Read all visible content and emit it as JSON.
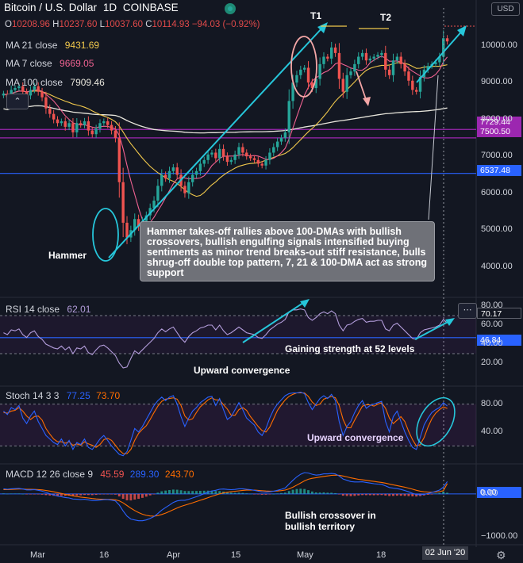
{
  "symbol": {
    "title": "Bitcoin / U.S. Dollar",
    "interval": "1D",
    "exchange": "COINBASE",
    "currency": "USD",
    "ohlc": {
      "o_label": "O",
      "o": "10208.96",
      "h_label": "H",
      "h": "10237.60",
      "l_label": "L",
      "l": "10037.60",
      "c_label": "C",
      "c": "10114.93",
      "change": "−94.03 (−0.92%)"
    }
  },
  "indicators": {
    "ma21": {
      "label": "MA 21 close",
      "value": "9431.69",
      "color": "#f2c94c"
    },
    "ma7": {
      "label": "MA 7 close",
      "value": "9669.05",
      "color": "#f06292"
    },
    "ma100": {
      "label": "MA 100 close",
      "value": "7909.46",
      "color": "#e8e6dc"
    },
    "rsi": {
      "label": "RSI 14 close",
      "value": "62.01",
      "color": "#b39ddb"
    },
    "stoch": {
      "label": "Stoch 14 3 3",
      "k": "77.25",
      "d": "73.70",
      "k_color": "#2962ff",
      "d_color": "#ff6d00"
    },
    "macd": {
      "label": "MACD 12 26 close 9",
      "hist": "45.59",
      "macd": "289.30",
      "signal": "243.70",
      "hist_color": "#ef5350",
      "macd_color": "#2962ff",
      "signal_color": "#ff6d00"
    }
  },
  "annotations": {
    "t1": "T1",
    "t2": "T2",
    "hammer": "Hammer",
    "note": "Hammer takes-off rallies above 100-DMAs with bullish crossovers, bullish engulfing signals intensified buying sentiments as minor trend breaks-out stiff resistance, bulls shrug-off double top pattern, 7, 21 & 100-DMA act as strong support",
    "rsi_text1": "Gaining strength at 52 levels",
    "rsi_text2": "Upward convergence",
    "stoch_text": "Upward convergence",
    "macd_text": "Bullish crossover in bullish territory"
  },
  "price_badges": [
    {
      "value": "7729.44",
      "color": "#9c27b0"
    },
    {
      "value": "7500.50",
      "color": "#9c27b0"
    },
    {
      "value": "6537.48",
      "color": "#2962ff"
    }
  ],
  "side_badges": {
    "rsi_a": "70.17",
    "rsi_b": "46.84",
    "macd_zero": "0.00"
  },
  "x_axis": {
    "ticks": [
      "Mar",
      "16",
      "Apr",
      "15",
      "May",
      "18"
    ],
    "cursor_date": "02 Jun '20"
  },
  "chart_data": [
    {
      "type": "candlestick",
      "pane": "price",
      "ylim": [
        3500,
        10700
      ],
      "y_ticks": [
        10000,
        9000,
        8000,
        7000,
        6000,
        5000,
        4000
      ],
      "y_tick_labels": [
        "10000.00",
        "9000.00",
        "8000.00",
        "7000.00",
        "6000.00",
        "5000.00",
        "4000.00"
      ],
      "candles_close": [
        8700,
        8600,
        8800,
        8850,
        8900,
        8750,
        8650,
        8800,
        8900,
        8750,
        8600,
        8300,
        8150,
        8000,
        7900,
        7950,
        7800,
        7900,
        7650,
        7900,
        7850,
        7950,
        7700,
        7600,
        7750,
        7900,
        7950,
        7850,
        7700,
        7500,
        6300,
        5200,
        4800,
        5000,
        5300,
        5100,
        5250,
        5400,
        5600,
        5800,
        6200,
        6500,
        6400,
        6600,
        6700,
        6500,
        6200,
        6000,
        6300,
        6500,
        6600,
        6800,
        6900,
        7050,
        7100,
        6950,
        7200,
        7000,
        6850,
        6900,
        7050,
        7250,
        7100,
        7000,
        6950,
        6900,
        6800,
        6750,
        6900,
        7100,
        7250,
        7400,
        7500,
        7650,
        8500,
        9000,
        9200,
        9350,
        9400,
        9000,
        8850,
        9100,
        9500,
        9700,
        9650,
        9950,
        9800,
        9100,
        8750,
        9200,
        9300,
        9500,
        9700,
        9800,
        9600,
        9650,
        9700,
        9750,
        9800,
        9350,
        9200,
        9600,
        9700,
        9500,
        9300,
        9050,
        8800,
        8750,
        9150,
        9350,
        9450,
        9500,
        9550,
        9700,
        10200,
        10114.93
      ],
      "hline_levels": [
        7729.44,
        7500.5,
        6537.48
      ]
    },
    {
      "type": "line",
      "pane": "rsi",
      "ylim": [
        10,
        85
      ],
      "y_ticks": [
        80,
        60,
        40,
        20
      ],
      "y_tick_labels": [
        "80.00",
        "60.00",
        "40.00",
        "20.00"
      ],
      "series": [
        {
          "name": "RSI 14 close",
          "values": [
            52,
            50,
            55,
            54,
            56,
            50,
            47,
            52,
            54,
            48,
            45,
            40,
            38,
            36,
            35,
            38,
            34,
            37,
            30,
            36,
            35,
            38,
            31,
            29,
            34,
            38,
            39,
            36,
            32,
            28,
            20,
            15,
            16,
            25,
            33,
            30,
            34,
            38,
            42,
            46,
            52,
            56,
            53,
            56,
            58,
            52,
            46,
            42,
            48,
            52,
            54,
            57,
            58,
            60,
            60,
            55,
            60,
            54,
            50,
            52,
            55,
            58,
            55,
            52,
            51,
            50,
            47,
            46,
            50,
            55,
            58,
            61,
            63,
            66,
            74,
            76,
            76,
            77,
            76,
            68,
            65,
            68,
            72,
            74,
            72,
            75,
            72,
            60,
            54,
            60,
            61,
            64,
            66,
            67,
            63,
            64,
            64,
            65,
            65,
            56,
            54,
            60,
            62,
            58,
            54,
            50,
            46,
            45,
            52,
            55,
            56,
            57,
            58,
            60,
            66,
            62
          ]
        }
      ],
      "hlines": [
        70,
        30
      ]
    },
    {
      "type": "line",
      "pane": "stoch",
      "ylim": [
        0,
        100
      ],
      "y_ticks": [
        80,
        40
      ],
      "y_tick_labels": [
        "80.00",
        "40.00"
      ],
      "series": [
        {
          "name": "K",
          "values": [
            70,
            65,
            75,
            72,
            78,
            60,
            52,
            63,
            70,
            55,
            45,
            35,
            30,
            25,
            22,
            30,
            20,
            28,
            15,
            25,
            22,
            30,
            18,
            15,
            22,
            30,
            35,
            28,
            20,
            14,
            8,
            6,
            12,
            28,
            45,
            40,
            48,
            58,
            68,
            78,
            85,
            90,
            85,
            90,
            92,
            80,
            62,
            48,
            60,
            70,
            75,
            82,
            86,
            90,
            91,
            78,
            88,
            72,
            58,
            62,
            72,
            82,
            72,
            60,
            55,
            50,
            40,
            35,
            45,
            60,
            72,
            80,
            86,
            92,
            95,
            96,
            96,
            97,
            95,
            82,
            72,
            80,
            88,
            92,
            88,
            94,
            85,
            55,
            35,
            48,
            55,
            68,
            78,
            85,
            74,
            78,
            80,
            82,
            84,
            55,
            40,
            62,
            70,
            55,
            40,
            28,
            18,
            15,
            32,
            50,
            60,
            68,
            72,
            75,
            82,
            77.25
          ]
        },
        {
          "name": "D",
          "values": [
            68,
            67,
            70,
            71,
            75,
            70,
            63,
            58,
            62,
            63,
            57,
            45,
            37,
            30,
            26,
            26,
            24,
            26,
            21,
            23,
            21,
            26,
            23,
            21,
            18,
            22,
            29,
            31,
            28,
            21,
            14,
            9,
            9,
            15,
            28,
            38,
            44,
            49,
            58,
            68,
            77,
            84,
            87,
            88,
            89,
            87,
            78,
            63,
            57,
            59,
            68,
            76,
            81,
            86,
            89,
            86,
            86,
            79,
            73,
            64,
            64,
            72,
            75,
            71,
            62,
            55,
            48,
            42,
            40,
            47,
            59,
            71,
            79,
            86,
            91,
            94,
            96,
            96,
            96,
            91,
            83,
            78,
            80,
            87,
            89,
            91,
            89,
            78,
            58,
            46,
            46,
            57,
            67,
            77,
            79,
            79,
            77,
            80,
            82,
            74,
            60,
            52,
            57,
            62,
            55,
            41,
            29,
            20,
            22,
            32,
            47,
            59,
            67,
            72,
            76,
            73.7
          ]
        }
      ],
      "hlines": [
        80,
        20
      ]
    },
    {
      "type": "macd",
      "pane": "macd",
      "ylim": [
        -1100,
        500
      ],
      "y_ticks": [
        0,
        -1000
      ],
      "y_tick_labels": [
        "0.00",
        "−1000.00"
      ],
      "series": [
        {
          "name": "MACD",
          "values": [
            120,
            110,
            120,
            125,
            130,
            115,
            95,
            95,
            100,
            85,
            65,
            35,
            5,
            -25,
            -50,
            -65,
            -85,
            -95,
            -120,
            -125,
            -130,
            -125,
            -140,
            -155,
            -155,
            -145,
            -135,
            -135,
            -145,
            -165,
            -260,
            -400,
            -520,
            -590,
            -610,
            -630,
            -630,
            -610,
            -575,
            -530,
            -460,
            -380,
            -320,
            -260,
            -200,
            -165,
            -150,
            -150,
            -125,
            -95,
            -65,
            -30,
            5,
            40,
            70,
            85,
            110,
            115,
            105,
            100,
            105,
            120,
            120,
            110,
            100,
            85,
            65,
            45,
            40,
            50,
            65,
            85,
            110,
            140,
            230,
            320,
            400,
            460,
            500,
            490,
            460,
            440,
            450,
            470,
            470,
            480,
            470,
            420,
            350,
            320,
            290,
            280,
            280,
            285,
            270,
            255,
            240,
            230,
            225,
            190,
            150,
            135,
            125,
            105,
            80,
            50,
            15,
            -15,
            -20,
            -10,
            10,
            35,
            60,
            90,
            160,
            289.3
          ]
        },
        {
          "name": "Signal",
          "values": [
            100,
            102,
            106,
            110,
            114,
            114,
            110,
            107,
            105,
            101,
            94,
            82,
            67,
            49,
            29,
            10,
            -9,
            -26,
            -45,
            -61,
            -75,
            -85,
            -96,
            -108,
            -118,
            -123,
            -126,
            -128,
            -131,
            -138,
            -162,
            -210,
            -272,
            -335,
            -390,
            -438,
            -476,
            -503,
            -518,
            -521,
            -509,
            -483,
            -450,
            -412,
            -370,
            -329,
            -293,
            -264,
            -237,
            -208,
            -180,
            -150,
            -119,
            -87,
            -56,
            -28,
            0,
            23,
            39,
            51,
            62,
            73,
            83,
            88,
            90,
            89,
            84,
            76,
            69,
            65,
            65,
            69,
            77,
            90,
            118,
            158,
            206,
            257,
            306,
            343,
            366,
            381,
            395,
            410,
            422,
            434,
            441,
            437,
            420,
            400,
            378,
            358,
            342,
            331,
            319,
            306,
            293,
            280,
            269,
            253,
            232,
            213,
            195,
            177,
            157,
            136,
            112,
            86,
            65,
            50,
            42,
            41,
            45,
            54,
            75,
            243.7
          ]
        }
      ]
    }
  ]
}
